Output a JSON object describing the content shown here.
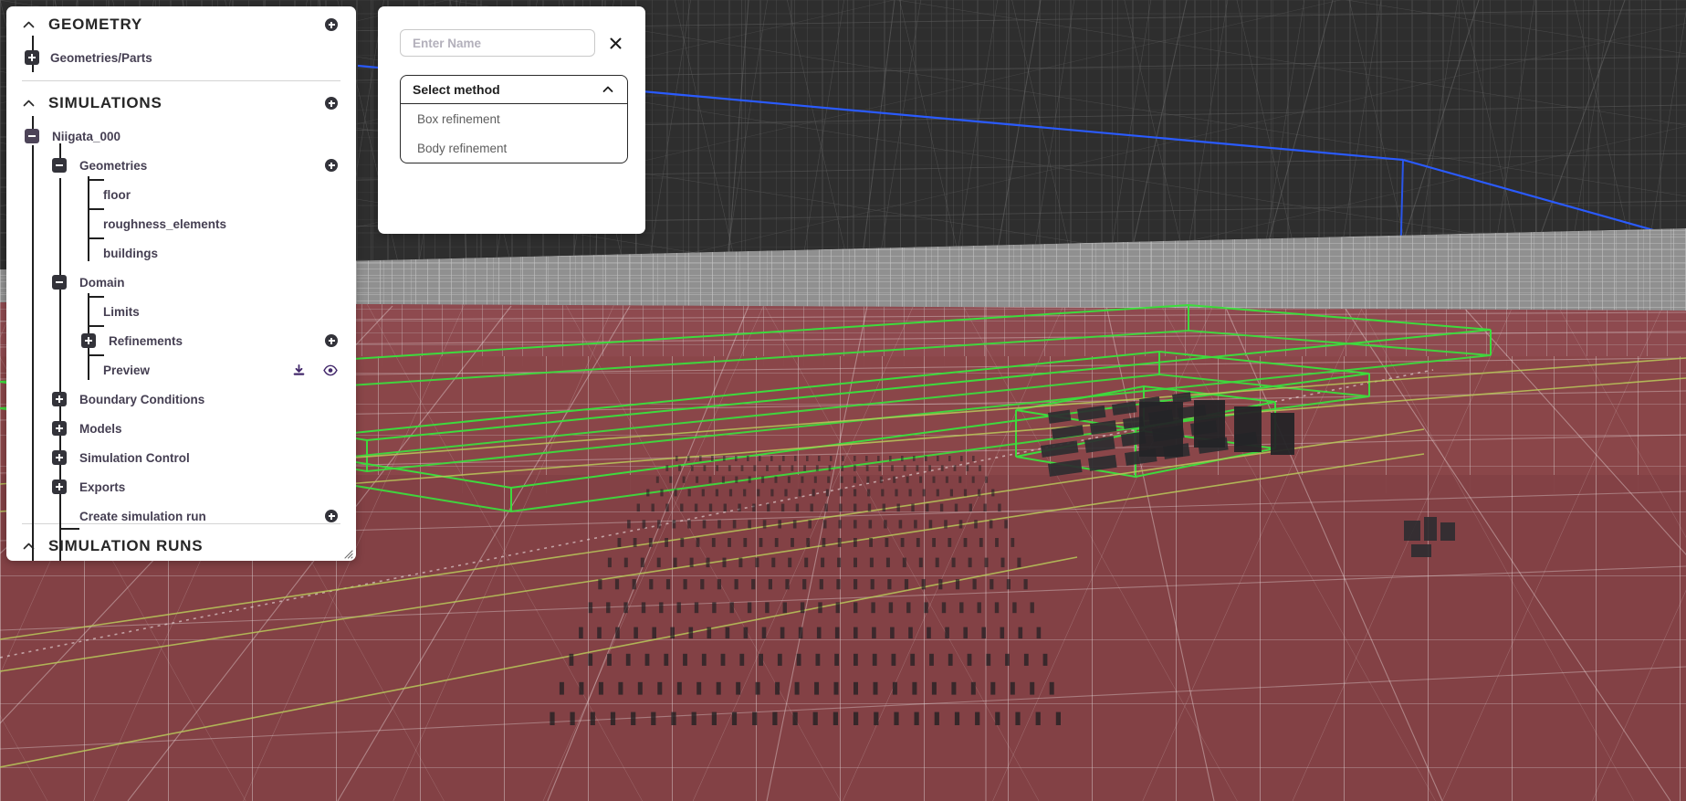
{
  "app": {
    "viewport_name": "3d-mesh-viewport"
  },
  "sidebar": {
    "sections": [
      {
        "key": "geometry",
        "title": "GEOMETRY",
        "collapse_icon": "chevron-up-icon",
        "add_icon": "plus-circle-icon",
        "items": [
          {
            "label": "Geometries/Parts",
            "toggle": "plus-square-icon"
          }
        ]
      },
      {
        "key": "simulations",
        "title": "SIMULATIONS",
        "collapse_icon": "chevron-up-icon",
        "add_icon": "plus-circle-icon"
      },
      {
        "key": "simulation_runs",
        "title": "SIMULATION RUNS",
        "collapse_icon": "chevron-up-icon"
      }
    ],
    "tree": {
      "root": {
        "label": "Niigata_000",
        "toggle": "minus-square-icon"
      },
      "nodes": [
        {
          "label": "Geometries",
          "toggle": "minus-square-icon",
          "add": "plus-circle-icon"
        },
        {
          "label": "floor",
          "toggle": "none"
        },
        {
          "label": "roughness_elements",
          "toggle": "none"
        },
        {
          "label": "buildings",
          "toggle": "none"
        },
        {
          "label": "Domain",
          "toggle": "minus-square-icon"
        },
        {
          "label": "Limits",
          "toggle": "none"
        },
        {
          "label": "Refinements",
          "toggle": "plus-square-icon",
          "add": "plus-circle-icon"
        },
        {
          "label": "Preview",
          "toggle": "none",
          "download": "download-icon",
          "visibility": "eye-icon"
        },
        {
          "label": "Boundary Conditions",
          "toggle": "plus-square-icon"
        },
        {
          "label": "Models",
          "toggle": "plus-square-icon"
        },
        {
          "label": "Simulation Control",
          "toggle": "plus-square-icon"
        },
        {
          "label": "Exports",
          "toggle": "plus-square-icon"
        },
        {
          "label": "Create simulation run",
          "toggle": "none",
          "add": "plus-circle-icon"
        }
      ]
    },
    "resize_handle": "resize-grip-icon"
  },
  "modal": {
    "name_field": {
      "value": "",
      "placeholder": "Enter Name"
    },
    "close_icon": "close-x-icon",
    "select": {
      "label": "Select method",
      "expanded": true,
      "arrow_icon": "chevron-up-icon",
      "options": [
        "Box refinement",
        "Body refinement"
      ]
    }
  },
  "colors": {
    "accent_purple": "#4d4458",
    "text": "#453f52",
    "toggle_dark": "#33333a",
    "ground": "#8c4a4e",
    "mesh_line": "#d8d8d8",
    "refinement_green": "#3ddb3d",
    "edge_blue": "#2a5bff",
    "background_dark": "#2b2b2b"
  }
}
